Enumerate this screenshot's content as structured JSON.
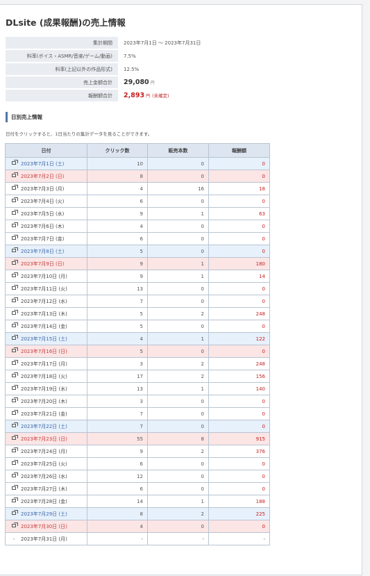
{
  "page": {
    "title": "DLsite (成果報酬)の売上情報"
  },
  "summary": [
    {
      "label": "集計期間",
      "value": "2023年7月1日 ～ 2023年7月31日"
    },
    {
      "label": "料率(ボイス・ASMR/音楽/ゲーム/動画)",
      "value": "7.5%"
    },
    {
      "label": "料率(上記以外の作品形式)",
      "value": "12.5%"
    },
    {
      "label": "売上金額合計",
      "value": "29,080",
      "unit": "円"
    },
    {
      "label": "報酬額合計",
      "value": "2,893",
      "unit": "円",
      "note": "(未確定)"
    }
  ],
  "section": {
    "title": "日別売上情報",
    "hint": "日付をクリックすると、1日当たりの集計データを見ることができます。"
  },
  "table": {
    "headers": [
      "日付",
      "クリック数",
      "販売本数",
      "報酬額"
    ],
    "rows": [
      {
        "date": "2023年7月1日 (土)",
        "clicks": "10",
        "sales": "0",
        "fee": "0",
        "type": "sat"
      },
      {
        "date": "2023年7月2日 (日)",
        "clicks": "8",
        "sales": "0",
        "fee": "0",
        "type": "sun"
      },
      {
        "date": "2023年7月3日 (月)",
        "clicks": "4",
        "sales": "16",
        "fee": "18",
        "type": "weekday"
      },
      {
        "date": "2023年7月4日 (火)",
        "clicks": "6",
        "sales": "0",
        "fee": "0",
        "type": "weekday"
      },
      {
        "date": "2023年7月5日 (水)",
        "clicks": "9",
        "sales": "1",
        "fee": "63",
        "type": "weekday"
      },
      {
        "date": "2023年7月6日 (木)",
        "clicks": "4",
        "sales": "0",
        "fee": "0",
        "type": "weekday"
      },
      {
        "date": "2023年7月7日 (金)",
        "clicks": "6",
        "sales": "0",
        "fee": "0",
        "type": "weekday"
      },
      {
        "date": "2023年7月8日 (土)",
        "clicks": "5",
        "sales": "0",
        "fee": "0",
        "type": "sat"
      },
      {
        "date": "2023年7月9日 (日)",
        "clicks": "9",
        "sales": "1",
        "fee": "180",
        "type": "sun"
      },
      {
        "date": "2023年7月10日 (月)",
        "clicks": "9",
        "sales": "1",
        "fee": "14",
        "type": "weekday"
      },
      {
        "date": "2023年7月11日 (火)",
        "clicks": "13",
        "sales": "0",
        "fee": "0",
        "type": "weekday"
      },
      {
        "date": "2023年7月12日 (水)",
        "clicks": "7",
        "sales": "0",
        "fee": "0",
        "type": "weekday"
      },
      {
        "date": "2023年7月13日 (木)",
        "clicks": "5",
        "sales": "2",
        "fee": "248",
        "type": "weekday"
      },
      {
        "date": "2023年7月14日 (金)",
        "clicks": "5",
        "sales": "0",
        "fee": "0",
        "type": "weekday"
      },
      {
        "date": "2023年7月15日 (土)",
        "clicks": "4",
        "sales": "1",
        "fee": "122",
        "type": "sat"
      },
      {
        "date": "2023年7月16日 (日)",
        "clicks": "5",
        "sales": "0",
        "fee": "0",
        "type": "sun"
      },
      {
        "date": "2023年7月17日 (月)",
        "clicks": "3",
        "sales": "2",
        "fee": "248",
        "type": "weekday"
      },
      {
        "date": "2023年7月18日 (火)",
        "clicks": "17",
        "sales": "2",
        "fee": "156",
        "type": "weekday"
      },
      {
        "date": "2023年7月19日 (水)",
        "clicks": "13",
        "sales": "1",
        "fee": "140",
        "type": "weekday"
      },
      {
        "date": "2023年7月20日 (木)",
        "clicks": "3",
        "sales": "0",
        "fee": "0",
        "type": "weekday"
      },
      {
        "date": "2023年7月21日 (金)",
        "clicks": "7",
        "sales": "0",
        "fee": "0",
        "type": "weekday"
      },
      {
        "date": "2023年7月22日 (土)",
        "clicks": "7",
        "sales": "0",
        "fee": "0",
        "type": "sat"
      },
      {
        "date": "2023年7月23日 (日)",
        "clicks": "55",
        "sales": "8",
        "fee": "915",
        "type": "sun"
      },
      {
        "date": "2023年7月24日 (月)",
        "clicks": "9",
        "sales": "2",
        "fee": "376",
        "type": "weekday"
      },
      {
        "date": "2023年7月25日 (火)",
        "clicks": "6",
        "sales": "0",
        "fee": "0",
        "type": "weekday"
      },
      {
        "date": "2023年7月26日 (水)",
        "clicks": "12",
        "sales": "0",
        "fee": "0",
        "type": "weekday"
      },
      {
        "date": "2023年7月27日 (木)",
        "clicks": "6",
        "sales": "0",
        "fee": "0",
        "type": "weekday"
      },
      {
        "date": "2023年7月28日 (金)",
        "clicks": "14",
        "sales": "1",
        "fee": "188",
        "type": "weekday"
      },
      {
        "date": "2023年7月29日 (土)",
        "clicks": "8",
        "sales": "2",
        "fee": "225",
        "type": "sat"
      },
      {
        "date": "2023年7月30日 (日)",
        "clicks": "4",
        "sales": "0",
        "fee": "0",
        "type": "sun"
      },
      {
        "date": "2023年7月31日 (月)",
        "clicks": "-",
        "sales": "-",
        "fee": "-",
        "type": "weekday",
        "no_link": true
      }
    ]
  },
  "colors": {
    "accent": "#5176a8",
    "fee_red": "#c41f1f",
    "saturday_bg": "#e7f1fb",
    "sunday_bg": "#fbe5e5",
    "header_bg": "#dde5f0"
  },
  "icons": {
    "date_link": "external-window-icon"
  }
}
